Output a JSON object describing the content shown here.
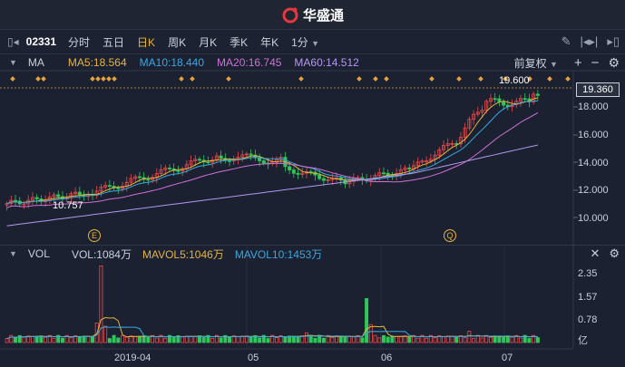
{
  "app": {
    "brand": "华盛通"
  },
  "toolbar": {
    "stock_code": "02331",
    "periods": [
      "分时",
      "五日",
      "日K",
      "周K",
      "月K",
      "季K",
      "年K"
    ],
    "active_period": "日K",
    "minute": "1分"
  },
  "ma_panel": {
    "indicator": "MA",
    "ma5": "MA5:18.564",
    "ma10": "MA10:18.440",
    "ma20": "MA20:16.745",
    "ma60": "MA60:14.512",
    "adjust": "前复权",
    "colors": {
      "ma5": "#e6b43c",
      "ma10": "#38a8e0",
      "ma20": "#d070d8",
      "ma60": "#b497f0",
      "up": "#f04848",
      "down": "#2fc65a"
    }
  },
  "price_axis": {
    "current": "19.360",
    "ticks": [
      "18.000",
      "16.000",
      "14.000",
      "12.000",
      "10.000"
    ],
    "high_label": "19.600",
    "low_label": "10.757"
  },
  "markers": {
    "e": "E",
    "q": "Q"
  },
  "vol_panel": {
    "indicator": "VOL",
    "vol": "VOL:1084万",
    "mavol5": "MAVOL5:1046万",
    "mavol10": "MAVOL10:1453万",
    "ticks": [
      "2.35",
      "1.57",
      "0.78"
    ],
    "unit": "亿"
  },
  "x_axis": {
    "labels": [
      "2019-04",
      "05",
      "06",
      "07"
    ]
  }
}
